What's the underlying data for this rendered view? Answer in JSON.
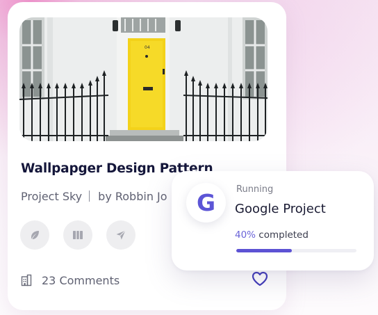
{
  "card": {
    "title": "Wallpapger Design Pattern",
    "project": "Project Sky",
    "author": "by Robbin Jo",
    "comments": "23 Comments",
    "actions": [
      "leaf-icon",
      "columns-icon",
      "send-icon"
    ],
    "photo_alt": "yellow-door-photo"
  },
  "project_card": {
    "status": "Running",
    "logo_letter": "G",
    "title": "Google Project",
    "progress_pct": "40%",
    "progress_suffix": " completed",
    "progress_value": 0.46,
    "accent": "#5c52d4"
  }
}
